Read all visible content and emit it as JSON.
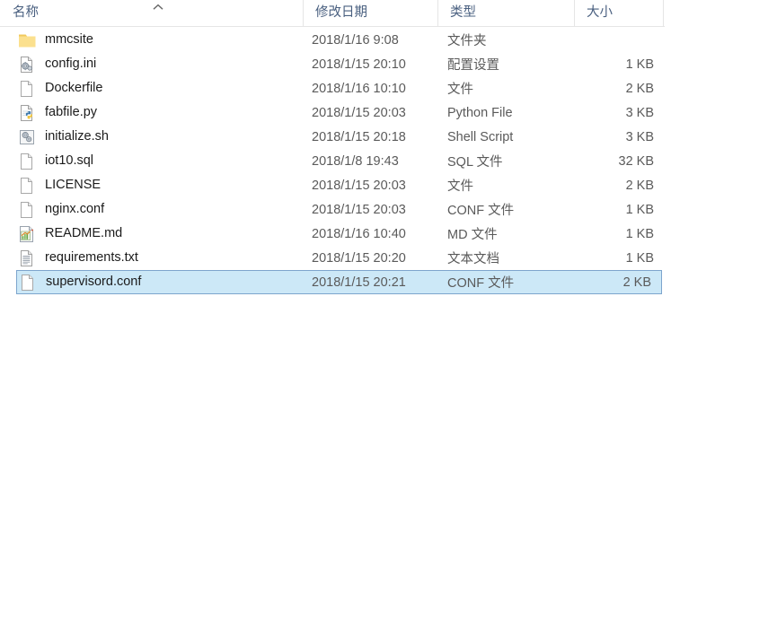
{
  "window": {
    "view": "details-list",
    "selection_color": "#cce8f7",
    "selection_border_color": "#7da5cd",
    "header_text_color": "#4a6080"
  },
  "columns": [
    {
      "key": "name",
      "label": "名称",
      "sorted": true,
      "sort_direction": "ascending",
      "sort_icon": "chevron-up-icon"
    },
    {
      "key": "date",
      "label": "修改日期",
      "sorted": false
    },
    {
      "key": "type",
      "label": "类型",
      "sorted": false
    },
    {
      "key": "size",
      "label": "大小",
      "sorted": false
    }
  ],
  "files": [
    {
      "name": "mmcsite",
      "date": "2018/1/16 9:08",
      "type": "文件夹",
      "size": "",
      "icon": "folder-icon",
      "selected": false
    },
    {
      "name": "config.ini",
      "date": "2018/1/15 20:10",
      "type": "配置设置",
      "size": "1 KB",
      "icon": "config-file-icon",
      "selected": false
    },
    {
      "name": "Dockerfile",
      "date": "2018/1/16 10:10",
      "type": "文件",
      "size": "2 KB",
      "icon": "generic-file-icon",
      "selected": false
    },
    {
      "name": "fabfile.py",
      "date": "2018/1/15 20:03",
      "type": "Python File",
      "size": "3 KB",
      "icon": "python-file-icon",
      "selected": false
    },
    {
      "name": "initialize.sh",
      "date": "2018/1/15 20:18",
      "type": "Shell Script",
      "size": "3 KB",
      "icon": "shell-script-icon",
      "selected": false
    },
    {
      "name": "iot10.sql",
      "date": "2018/1/8 19:43",
      "type": "SQL 文件",
      "size": "32 KB",
      "icon": "generic-file-icon",
      "selected": false
    },
    {
      "name": "LICENSE",
      "date": "2018/1/15 20:03",
      "type": "文件",
      "size": "2 KB",
      "icon": "generic-file-icon",
      "selected": false
    },
    {
      "name": "nginx.conf",
      "date": "2018/1/15 20:03",
      "type": "CONF 文件",
      "size": "1 KB",
      "icon": "generic-file-icon",
      "selected": false
    },
    {
      "name": "README.md",
      "date": "2018/1/16 10:40",
      "type": "MD 文件",
      "size": "1 KB",
      "icon": "markdown-file-icon",
      "selected": false
    },
    {
      "name": "requirements.txt",
      "date": "2018/1/15 20:20",
      "type": "文本文档",
      "size": "1 KB",
      "icon": "text-file-icon",
      "selected": false
    },
    {
      "name": "supervisord.conf",
      "date": "2018/1/15 20:21",
      "type": "CONF 文件",
      "size": "2 KB",
      "icon": "generic-file-icon",
      "selected": true
    }
  ]
}
